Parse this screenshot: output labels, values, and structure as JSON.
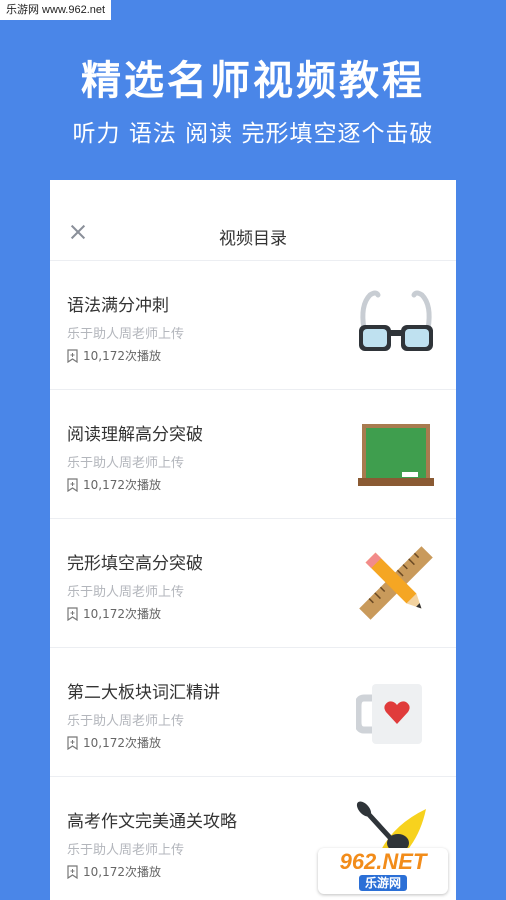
{
  "watermark_top": "乐游网 www.962.net",
  "hero": {
    "title": "精选名师视频教程",
    "subtitle": "听力 语法 阅读 完形填空逐个击破"
  },
  "panel": {
    "title": "视频目录",
    "courses": [
      {
        "title": "语法满分冲刺",
        "author": "乐于助人周老师上传",
        "plays": "10,172次播放",
        "icon": "glasses-icon"
      },
      {
        "title": "阅读理解高分突破",
        "author": "乐于助人周老师上传",
        "plays": "10,172次播放",
        "icon": "blackboard-icon"
      },
      {
        "title": "完形填空高分突破",
        "author": "乐于助人周老师上传",
        "plays": "10,172次播放",
        "icon": "pencil-ruler-icon"
      },
      {
        "title": "第二大板块词汇精讲",
        "author": "乐于助人周老师上传",
        "plays": "10,172次播放",
        "icon": "heart-mug-icon"
      },
      {
        "title": "高考作文完美通关攻略",
        "author": "乐于助人周老师上传",
        "plays": "10,172次播放",
        "icon": "kayak-icon"
      }
    ]
  },
  "watermark_bottom": {
    "brand": "962.NET",
    "name": "乐游网"
  },
  "colors": {
    "background": "#4a86e8",
    "panel": "#ffffff",
    "accent_text": "#333333"
  }
}
